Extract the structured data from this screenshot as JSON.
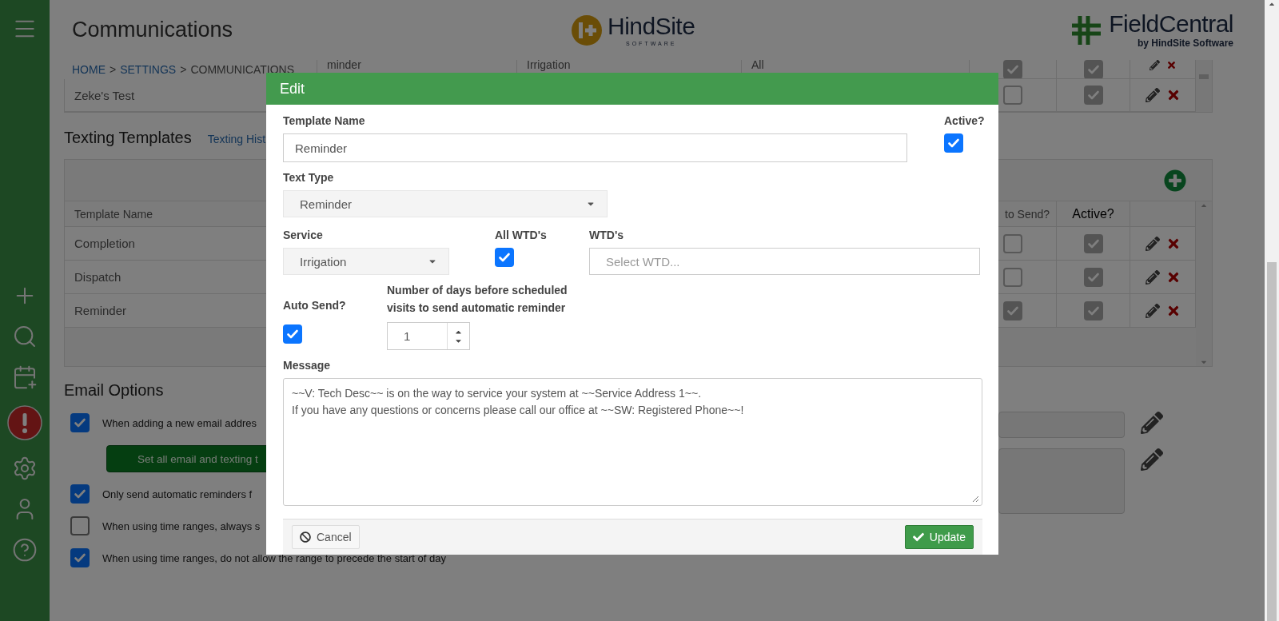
{
  "header": {
    "title": "Communications",
    "breadcrumb": [
      {
        "label": "HOME",
        "link": true
      },
      {
        "label": "SETTINGS",
        "link": true
      },
      {
        "label": "COMMUNICATIONS",
        "link": false
      }
    ],
    "breadcrumb_separator": ">",
    "logo_center": {
      "name": "HindSite",
      "tagline": "SOFTWARE"
    },
    "logo_right": {
      "name": "FieldCentral",
      "tagline": "by HindSite Software"
    }
  },
  "top_table": {
    "rows": [
      {
        "column_2": "minder",
        "column_3": "Irrigation",
        "column_4": "All",
        "check_1": true,
        "check_2": true
      },
      {
        "column_1": "Zeke's Test",
        "check_1": false,
        "check_2": true
      }
    ]
  },
  "texting_templates": {
    "title": "Texting Templates",
    "history_link": "Texting Hist",
    "columns": [
      "Template Name",
      "to Send?",
      "Active?"
    ],
    "rows": [
      {
        "name": "Completion",
        "auto_send": false,
        "active": true
      },
      {
        "name": "Dispatch",
        "auto_send": false,
        "active": true
      },
      {
        "name": "Reminder",
        "auto_send": true,
        "active": true
      }
    ]
  },
  "email_options": {
    "title": "Email Options",
    "items": [
      {
        "label": "When adding a new email addres",
        "checked": true,
        "button": "Set all email and texting t"
      },
      {
        "label": "Only send automatic reminders f",
        "checked": true
      },
      {
        "label": "When using time ranges, always s",
        "checked": false
      },
      {
        "label": "When using time ranges, do not allow the range to precede the start of day",
        "checked": true
      }
    ]
  },
  "modal": {
    "title": "Edit",
    "template_name": {
      "label": "Template Name",
      "value": "Reminder"
    },
    "active": {
      "label": "Active?",
      "checked": true
    },
    "text_type": {
      "label": "Text Type",
      "value": "Reminder"
    },
    "service": {
      "label": "Service",
      "value": "Irrigation"
    },
    "all_wtds": {
      "label": "All WTD's",
      "checked": true
    },
    "wtds": {
      "label": "WTD's",
      "placeholder": "Select WTD..."
    },
    "auto_send": {
      "label": "Auto Send?",
      "checked": true
    },
    "days_before": {
      "label": "Number of days before scheduled visits to send automatic reminder",
      "value": "1"
    },
    "message": {
      "label": "Message",
      "value": "~~V: Tech Desc~~ is on the way to service your system at ~~Service Address 1~~.\nIf you have any questions or concerns please call our office at ~~SW: Registered Phone~~!"
    },
    "cancel": {
      "label": "Cancel"
    },
    "update": {
      "label": "Update"
    }
  }
}
